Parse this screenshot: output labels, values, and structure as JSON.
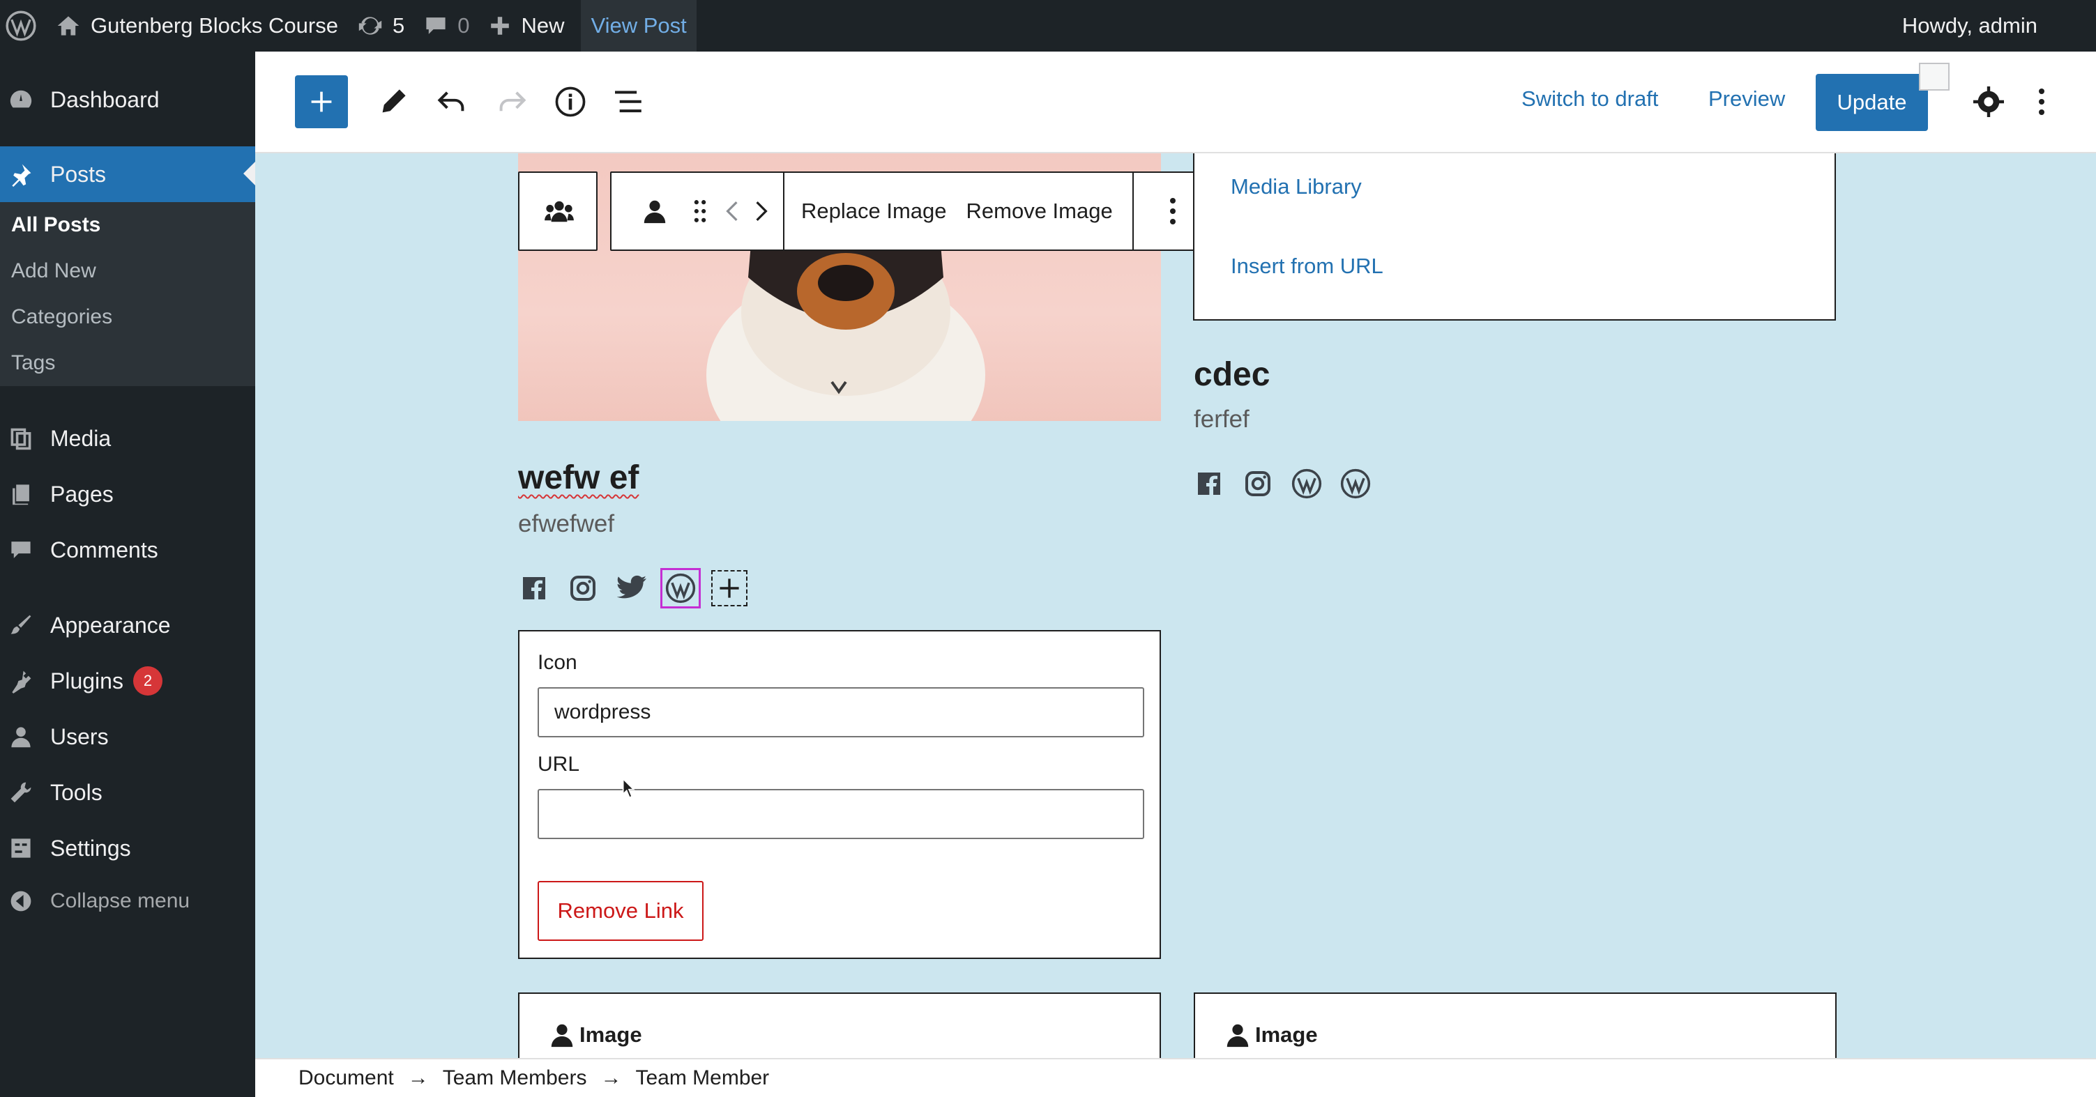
{
  "admin_bar": {
    "site_name": "Gutenberg Blocks Course",
    "updates_count": "5",
    "comments_count": "0",
    "new_label": "New",
    "view_post_label": "View Post",
    "howdy": "Howdy, admin"
  },
  "sidebar": {
    "items": [
      {
        "label": "Dashboard",
        "icon": "dashboard-icon"
      },
      {
        "label": "Posts",
        "icon": "pin-icon"
      },
      {
        "label": "Media",
        "icon": "media-icon"
      },
      {
        "label": "Pages",
        "icon": "pages-icon"
      },
      {
        "label": "Comments",
        "icon": "comments-icon"
      },
      {
        "label": "Appearance",
        "icon": "brush-icon"
      },
      {
        "label": "Plugins",
        "icon": "plugins-icon",
        "badge": "2"
      },
      {
        "label": "Users",
        "icon": "users-icon"
      },
      {
        "label": "Tools",
        "icon": "wrench-icon"
      },
      {
        "label": "Settings",
        "icon": "settings-icon"
      },
      {
        "label": "Collapse menu",
        "icon": "collapse-icon"
      }
    ],
    "posts_submenu": [
      "All Posts",
      "Add New",
      "Categories",
      "Tags"
    ]
  },
  "editor_header": {
    "switch_to_draft": "Switch to draft",
    "preview": "Preview",
    "update": "Update"
  },
  "block_toolbar": {
    "replace_image": "Replace Image",
    "remove_image": "Remove Image"
  },
  "media_placeholder": {
    "media_library": "Media Library",
    "insert_from_url": "Insert from URL"
  },
  "member_left": {
    "name": "wefw ef",
    "bio": "efwefwef",
    "social_icons": [
      "facebook-icon",
      "instagram-icon",
      "twitter-icon",
      "wordpress-icon",
      "add-icon"
    ]
  },
  "member_right": {
    "name": "cdec",
    "bio": "ferfef",
    "social_icons": [
      "facebook-icon",
      "instagram-icon",
      "wordpress-icon",
      "wordpress-icon"
    ]
  },
  "link_panel": {
    "icon_label": "Icon",
    "icon_value": "wordpress",
    "url_label": "URL",
    "url_value": "",
    "remove_link": "Remove Link"
  },
  "image_cards": [
    {
      "label": "Image"
    },
    {
      "label": "Image"
    }
  ],
  "breadcrumb": [
    "Document",
    "Team Members",
    "Team Member"
  ],
  "colors": {
    "admin_dark": "#1d2327",
    "accent": "#2271b1",
    "canvas_bg": "#cce6ef",
    "danger": "#cc1818"
  }
}
